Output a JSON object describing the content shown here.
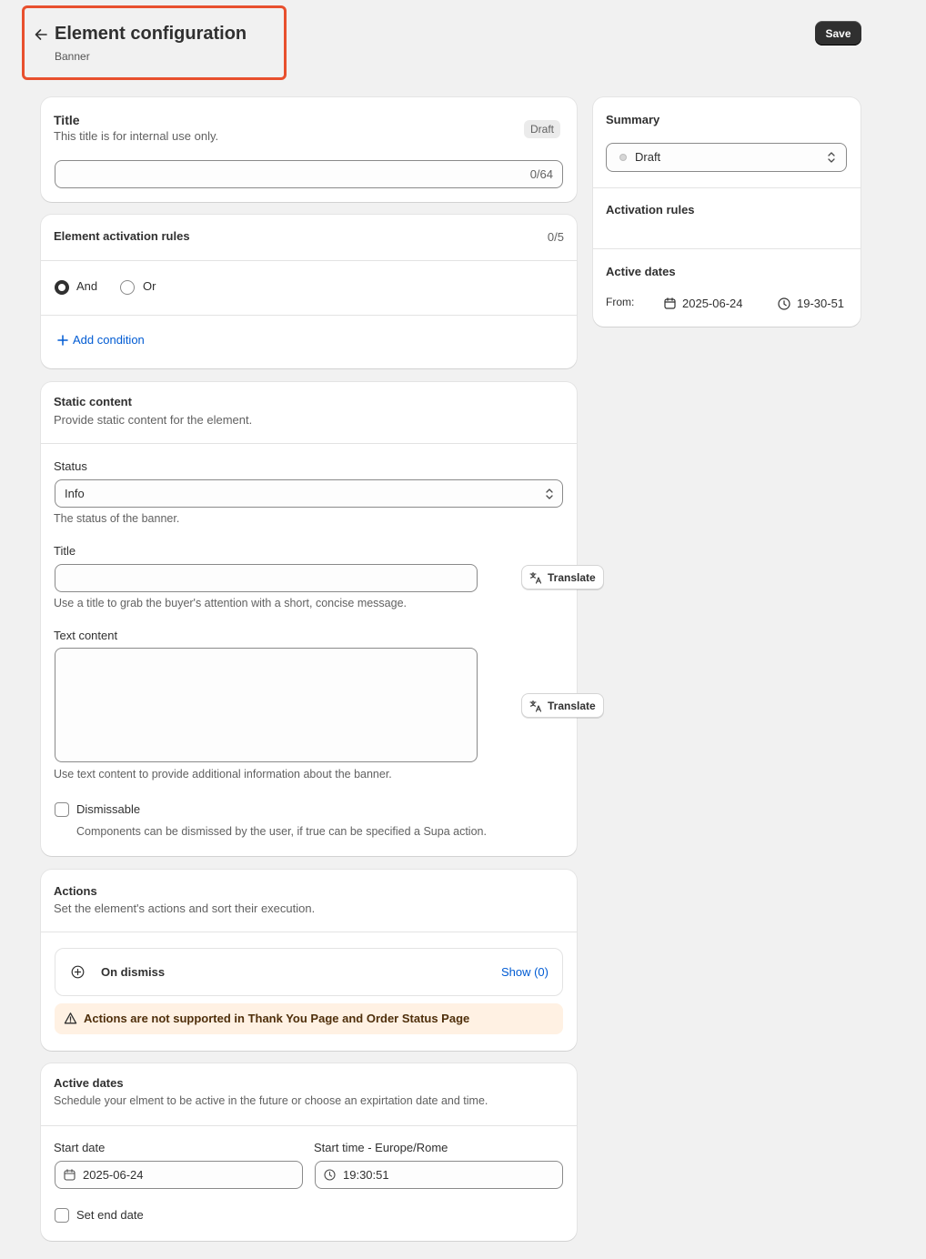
{
  "header": {
    "title": "Element configuration",
    "subtitle": "Banner",
    "save_label": "Save"
  },
  "title_card": {
    "heading": "Title",
    "description": "This title is for internal use only.",
    "badge": "Draft",
    "input_value": "",
    "counter": "0/64"
  },
  "activation_card": {
    "heading": "Element activation rules",
    "counter": "0/5",
    "and_label": "And",
    "or_label": "Or",
    "selected": "And",
    "add_condition_label": "Add condition"
  },
  "static_card": {
    "heading": "Static content",
    "description": "Provide static content for the element.",
    "status_label": "Status",
    "status_value": "Info",
    "status_help": "The status of the banner.",
    "title_label": "Title",
    "title_value": "",
    "title_help": "Use a title to grab the buyer's attention with a short, concise message.",
    "translate_label": "Translate",
    "text_label": "Text content",
    "text_value": "",
    "text_help": "Use text content to provide additional information about the banner.",
    "dismissable_label": "Dismissable",
    "dismissable_help": "Components can be dismissed by the user, if true can be specified a Supa action."
  },
  "actions_card": {
    "heading": "Actions",
    "description": "Set the element's actions and sort their execution.",
    "on_dismiss_label": "On dismiss",
    "show_label": "Show (0)",
    "warning": "Actions are not supported in Thank You Page and Order Status Page"
  },
  "dates_card": {
    "heading": "Active dates",
    "description": "Schedule your elment to be active in the future or choose an expirtation date and time.",
    "start_date_label": "Start date",
    "start_date_value": "2025-06-24",
    "start_time_label": "Start time - Europe/Rome",
    "start_time_value": "19:30:51",
    "end_date_label": "Set end date"
  },
  "summary": {
    "heading": "Summary",
    "status_value": "Draft",
    "activation_heading": "Activation rules",
    "dates_heading": "Active dates",
    "from_label": "From:",
    "from_date": "2025-06-24",
    "from_time": "19-30-51"
  }
}
